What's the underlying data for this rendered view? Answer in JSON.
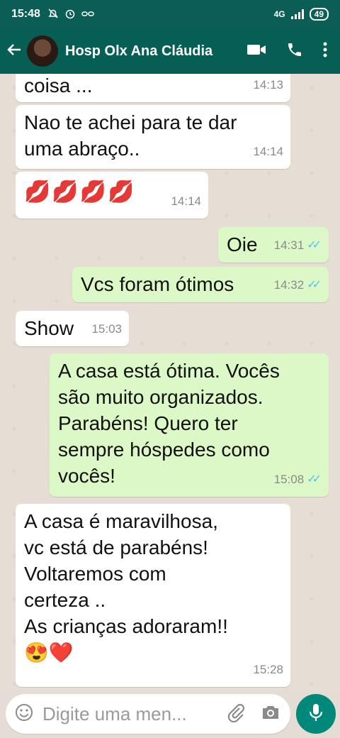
{
  "status_bar": {
    "time": "15:48",
    "network": "4G",
    "battery": "49"
  },
  "header": {
    "contact_name": "Hosp Olx Ana Cláudia"
  },
  "messages": [
    {
      "direction": "in",
      "text": "coisa ...",
      "time": "14:13"
    },
    {
      "direction": "in",
      "text": "Nao te achei  para te dar\numa abraço..",
      "time": "14:14"
    },
    {
      "direction": "in",
      "text": "💋💋💋💋",
      "time": "14:14"
    },
    {
      "direction": "out",
      "text": "Oie",
      "time": "14:31",
      "read": true
    },
    {
      "direction": "out",
      "text": "Vcs foram ótimos",
      "time": "14:32",
      "read": true
    },
    {
      "direction": "in",
      "text": "Show",
      "time": "15:03"
    },
    {
      "direction": "out",
      "text": "A casa está ótima. Vocês\nsão muito organizados.\nParabéns! Quero ter\nsempre hóspedes como\nvocês!",
      "time": "15:08",
      "read": true
    },
    {
      "direction": "in",
      "text": "A casa é maravilhosa,\nvc está de parabéns!\nVoltaremos com\ncerteza ..\nAs crianças adoraram!!\n😍❤️",
      "time": "15:28"
    }
  ],
  "input": {
    "placeholder": "Digite uma men..."
  },
  "colors": {
    "header": "#075e54",
    "outgoing_bubble": "#dcf8c6",
    "incoming_bubble": "#ffffff",
    "read_ticks": "#4fc3f7",
    "mic_button": "#00897b"
  }
}
